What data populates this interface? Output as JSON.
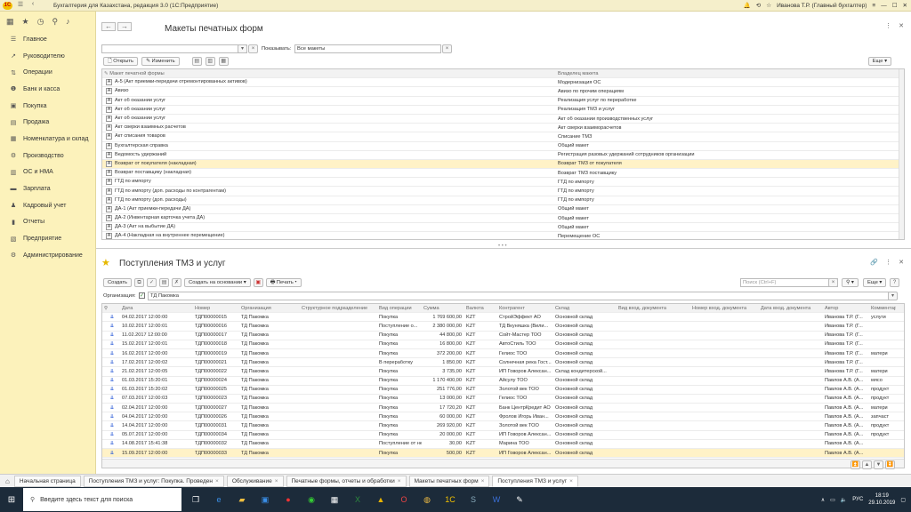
{
  "window": {
    "title": "Бухгалтерия для Казахстана, редакция 3.0  (1С:Предприятие)",
    "user": "Иванова Т.Р. (Главный бухгалтер)"
  },
  "sidebar": {
    "items": [
      {
        "label": "Главное",
        "icon": "menu-icon"
      },
      {
        "label": "Руководителю",
        "icon": "chart-icon"
      },
      {
        "label": "Операции",
        "icon": "operations-icon"
      },
      {
        "label": "Банк и касса",
        "icon": "bank-icon"
      },
      {
        "label": "Покупка",
        "icon": "cart-icon"
      },
      {
        "label": "Продажа",
        "icon": "sale-icon"
      },
      {
        "label": "Номенклатура и склад",
        "icon": "warehouse-icon"
      },
      {
        "label": "Производство",
        "icon": "production-icon"
      },
      {
        "label": "ОС и НМА",
        "icon": "assets-icon"
      },
      {
        "label": "Зарплата",
        "icon": "salary-icon"
      },
      {
        "label": "Кадровый учет",
        "icon": "people-icon"
      },
      {
        "label": "Отчеты",
        "icon": "reports-icon"
      },
      {
        "label": "Предприятие",
        "icon": "enterprise-icon"
      },
      {
        "label": "Администрирование",
        "icon": "gear-icon"
      }
    ]
  },
  "top": {
    "title": "Макеты печатных форм",
    "show_label": "Показывать:",
    "show_value": "Все макеты",
    "open_label": "Открыть",
    "edit_label": "Изменить",
    "more_label": "Еще",
    "columns": [
      "Макет печатной формы",
      "Владелец макета"
    ],
    "rows": [
      [
        "А-5 (Акт приемки-передачи отремонтированных активов)",
        "Модернизация ОС"
      ],
      [
        "Авизо",
        "Авизо по прочим операциям"
      ],
      [
        "Акт об оказании услуг",
        "Реализация услуг по переработке"
      ],
      [
        "Акт об оказании услуг",
        "Реализация ТМЗ и услуг"
      ],
      [
        "Акт об оказании услуг",
        "Акт об оказании производственных услуг"
      ],
      [
        "Акт сверки взаимных расчетов",
        "Акт сверки взаиморасчетов"
      ],
      [
        "Акт списания товаров",
        "Списание ТМЗ"
      ],
      [
        "Бухгалтерская справка",
        "Общий макет"
      ],
      [
        "Ведомость удержаний",
        "Регистрация разовых удержаний сотрудников организации"
      ],
      [
        "Возврат от покупателя (накладная)",
        "Возврат ТМЗ от покупателя"
      ],
      [
        "Возврат поставщику (накладная)",
        "Возврат ТМЗ поставщику"
      ],
      [
        "ГТД по импорту",
        "ГТД по импорту"
      ],
      [
        "ГТД по импорту (доп. расходы по контрагентам)",
        "ГТД по импорту"
      ],
      [
        "ГТД по импорту (доп. расходы)",
        "ГТД по импорту"
      ],
      [
        "ДА-1 (Акт приемки-передачи ДА)",
        "Общий макет"
      ],
      [
        "ДА-2 (Инвентарная карточка учета ДА)",
        "Общий макет"
      ],
      [
        "ДА-3 (Акт на выбытие ДА)",
        "Общий макет"
      ],
      [
        "ДА-4 (Накладная на внутреннее перемещение)",
        "Перемещение ОС"
      ]
    ]
  },
  "bottom": {
    "title": "Поступления ТМЗ и услуг",
    "create_label": "Создать",
    "create_based_label": "Создать на основании",
    "print_label": "Печать",
    "search_placeholder": "Поиск (Ctrl+F)",
    "more_label": "Еще",
    "org_label": "Организация:",
    "org_value": "ТД Пакомка",
    "columns": [
      "Дата",
      "Номер",
      "Организация",
      "Структурное подразделение",
      "Вид операции",
      "Сумма",
      "Валюта",
      "Контрагент",
      "Склад",
      "Вид вход. документа",
      "Номер вход. документа",
      "Дата вход. документа",
      "Автор",
      "Комментарий"
    ],
    "rows": [
      [
        "04.02.2017 12:00:00",
        "ТДП00000015",
        "ТД Пакомка",
        "",
        "Покупка",
        "1 769 600,00",
        "KZT",
        "СтройЭффект АО",
        "Основной склад",
        "",
        "",
        "",
        "Иванова Т.Р. (Г...",
        "услуги"
      ],
      [
        "10.02.2017 12:00:01",
        "ТДП00000016",
        "ТД Пакомка",
        "",
        "Поступление о...",
        "2 380 000,00",
        "KZT",
        "ТД Вкуняшка (Вили...",
        "Основной склад",
        "",
        "",
        "",
        "Иванова Т.Р. (Г...",
        ""
      ],
      [
        "11.02.2017 12:00:00",
        "ТДП00000017",
        "ТД Пакомка",
        "",
        "Покупка",
        "44 800,00",
        "KZT",
        "Сойт-Мастер ТОО",
        "Основной склад",
        "",
        "",
        "",
        "Иванова Т.Р. (Г...",
        ""
      ],
      [
        "15.02.2017 12:00:01",
        "ТДП00000018",
        "ТД Пакомка",
        "",
        "Покупка",
        "16 800,00",
        "KZT",
        "АвтоСтиль ТОО",
        "Основной склад",
        "",
        "",
        "",
        "Иванова Т.Р. (Г...",
        ""
      ],
      [
        "16.02.2017 12:00:00",
        "ТДП00000019",
        "ТД Пакомка",
        "",
        "Покупка",
        "372 200,00",
        "KZT",
        "Гелиос ТОО",
        "Основной склад",
        "",
        "",
        "",
        "Иванова Т.Р. (Г...",
        "матери"
      ],
      [
        "17.02.2017 12:00:02",
        "ТДП00000021",
        "ТД Пакомка",
        "",
        "В переработку",
        "1 850,00",
        "KZT",
        "Солнечная река Гост...",
        "Основной склад",
        "",
        "",
        "",
        "Иванова Т.Р. (Г...",
        ""
      ],
      [
        "21.02.2017 12:00:05",
        "ТДП00000022",
        "ТД Пакомка",
        "",
        "Покупка",
        "3 735,00",
        "KZT",
        "ИП Говоров Алексан...",
        "Склад кондитерской...",
        "",
        "",
        "",
        "Иванова Т.Р. (Г...",
        "матери"
      ],
      [
        "01.03.2017 15:20:01",
        "ТДП00000024",
        "ТД Пакомка",
        "",
        "Покупка",
        "1 170 400,00",
        "KZT",
        "Айсулу ТОО",
        "Основной склад",
        "",
        "",
        "",
        "Павлов А.В. (А...",
        "мясо"
      ],
      [
        "01.03.2017 15:20:02",
        "ТДП00000025",
        "ТД Пакомка",
        "",
        "Покупка",
        "251 776,00",
        "KZT",
        "Золотой век ТОО",
        "Основной склад",
        "",
        "",
        "",
        "Павлов А.В. (А...",
        "продукт"
      ],
      [
        "07.03.2017 12:00:03",
        "ТДП00000023",
        "ТД Пакомка",
        "",
        "Покупка",
        "13 000,00",
        "KZT",
        "Гелиос ТОО",
        "Основной склад",
        "",
        "",
        "",
        "Павлов А.В. (А...",
        "продукт"
      ],
      [
        "02.04.2017 12:00:00",
        "ТДП00000027",
        "ТД Пакомка",
        "",
        "Покупка",
        "17 720,20",
        "KZT",
        "Банк ЦентрКредит АО",
        "Основной склад",
        "",
        "",
        "",
        "Павлов А.В. (А...",
        "матери"
      ],
      [
        "04.04.2017 12:00:00",
        "ТДП00000026",
        "ТД Пакомка",
        "",
        "Покупка",
        "60 000,00",
        "KZT",
        "Фролов Игорь Иван...",
        "Основной склад",
        "",
        "",
        "",
        "Павлов А.В. (А...",
        "запчаст"
      ],
      [
        "14.04.2017 12:00:00",
        "ТДП00000031",
        "ТД Пакомка",
        "",
        "Покупка",
        "269 920,00",
        "KZT",
        "Золотой век ТОО",
        "Основной склад",
        "",
        "",
        "",
        "Павлов А.В. (А...",
        "продукт"
      ],
      [
        "05.07.2017 12:00:00",
        "ТДП00000034",
        "ТД Пакомка",
        "",
        "Покупка",
        "20 000,00",
        "KZT",
        "ИП Говоров Алексан...",
        "Основной склад",
        "",
        "",
        "",
        "Павлов А.В. (А...",
        "продукт"
      ],
      [
        "14.08.2017 15:41:38",
        "ТДП00000032",
        "ТД Пакомка",
        "",
        "Поступление от нерезидента",
        "30,00",
        "KZT",
        "Марина ТОО",
        "Основной склад",
        "",
        "",
        "",
        "Павлов А.В. (А...",
        ""
      ],
      [
        "15.09.2017 12:00:00",
        "ТДП00000033",
        "ТД Пакомка",
        "",
        "Покупка",
        "500,00",
        "KZT",
        "ИП Говоров Алексан...",
        "Основной склад",
        "",
        "",
        "",
        "Павлов А.В. (А...",
        ""
      ]
    ]
  },
  "tabs": [
    {
      "label": "Начальная страница"
    },
    {
      "label": "Поступления ТМЗ и услуг: Покупка. Проведен"
    },
    {
      "label": "Обслуживание"
    },
    {
      "label": "Печатные формы, отчеты и обработки"
    },
    {
      "label": "Макеты печатных форм"
    },
    {
      "label": "Поступления ТМЗ и услуг"
    }
  ],
  "taskbar": {
    "search_placeholder": "Введите здесь текст для поиска",
    "lang": "РУС",
    "time": "18:19",
    "date": "29.10.2019"
  },
  "colors": {
    "sidebar": "#fcf2bb",
    "selected_row": "#fff2c7",
    "taskbar": "#1c2b3a",
    "accent": "#f2c100"
  }
}
